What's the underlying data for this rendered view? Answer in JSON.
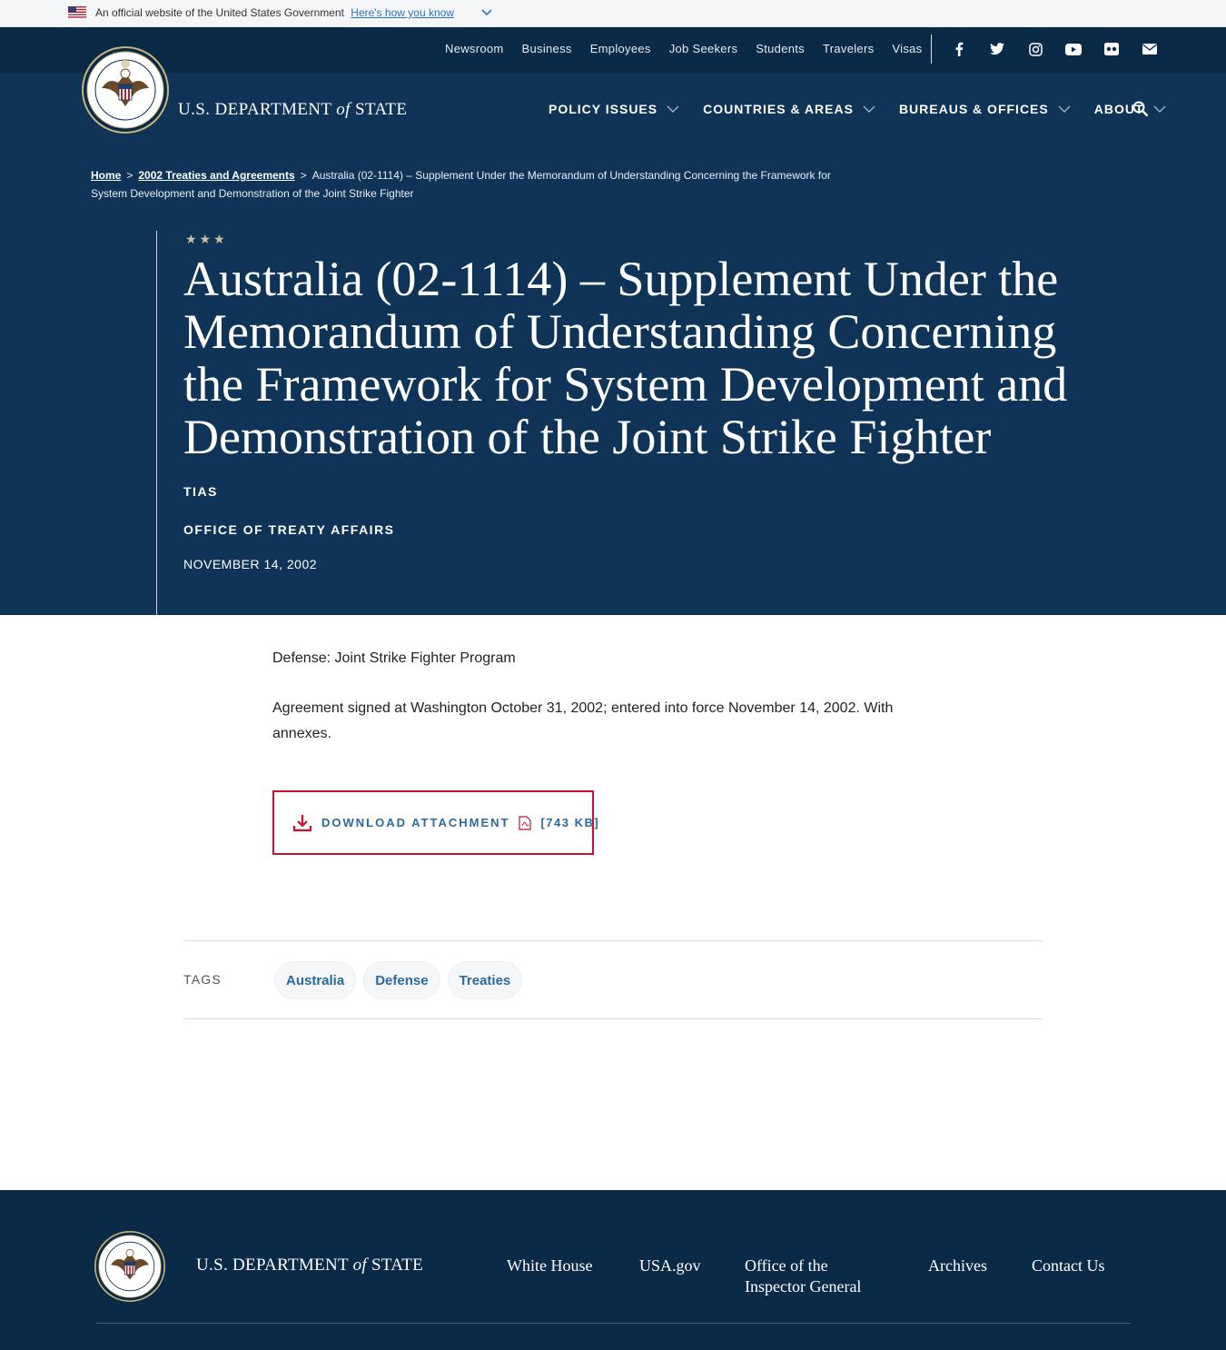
{
  "gov_banner": {
    "text": "An official website of the United States Government",
    "link": "Here's how you know"
  },
  "top_nav": {
    "links": [
      "Newsroom",
      "Business",
      "Employees",
      "Job Seekers",
      "Students",
      "Travelers",
      "Visas"
    ],
    "social_icons": [
      "facebook-icon",
      "twitter-icon",
      "instagram-icon",
      "youtube-icon",
      "flickr-icon",
      "email-icon"
    ]
  },
  "brand": {
    "name_prefix": "U.S. DEPARTMENT",
    "name_of": "of",
    "name_suffix": "STATE"
  },
  "main_nav": {
    "items": [
      "Policy Issues",
      "Countries & Areas",
      "Bureaus & Offices",
      "About"
    ]
  },
  "breadcrumb": {
    "home": "Home",
    "section": "2002 Treaties and Agreements",
    "current": "Australia (02-1114) – Supplement Under the Memorandum of Understanding Concerning the Framework for System Development and Demonstration of the Joint Strike Fighter"
  },
  "hero": {
    "title": "Australia (02-1114) – Supplement Under the Memorandum of Understanding Concerning the Framework for System Development and Demonstration of the Joint Strike Fighter",
    "category": "TIAS",
    "office": "Office of Treaty Affairs",
    "date": "November 14, 2002"
  },
  "body": {
    "subject": "Defense: Joint Strike Fighter Program",
    "description": "Agreement signed at Washington October 31, 2002; entered into force November 14, 2002.  With annexes."
  },
  "download": {
    "label": "Download Attachment",
    "size": "[743 KB]"
  },
  "tags": {
    "label": "Tags",
    "items": [
      "Australia",
      "Defense",
      "Treaties"
    ]
  },
  "footer": {
    "links": [
      "White House",
      "USA.gov",
      "Office of the Inspector General",
      "Archives",
      "Contact Us"
    ]
  },
  "colors": {
    "navy": "#0f3457",
    "navy_dark": "#0b2a48",
    "accent_red": "#c8102e",
    "link_blue": "#2b6a9c"
  }
}
